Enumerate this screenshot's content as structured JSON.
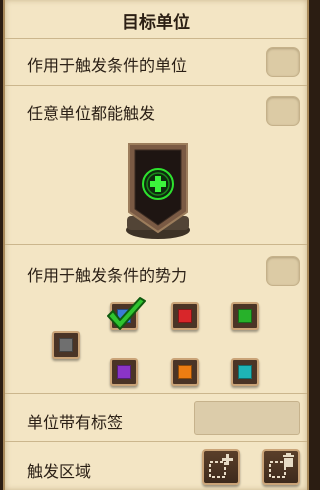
{
  "panel": {
    "title": "目标单位"
  },
  "options": {
    "trigger_unit_label": "作用于触发条件的单位",
    "any_unit_label": "任意单位都能触发",
    "trigger_force_label": "作用于触发条件的势力",
    "unit_tag_label": "单位带有标签",
    "trigger_area_label": "触发区域"
  },
  "unit_tag": {
    "value": ""
  },
  "team_colors": [
    {
      "name": "gray",
      "color": "#6f6f6f"
    },
    {
      "name": "blue",
      "color": "#3b7bd6"
    },
    {
      "name": "red",
      "color": "#d8262a"
    },
    {
      "name": "green",
      "color": "#27b12a"
    },
    {
      "name": "purple",
      "color": "#8a34c7"
    },
    {
      "name": "orange",
      "color": "#ee7d12"
    },
    {
      "name": "teal",
      "color": "#1eb4b6"
    }
  ],
  "selected_team": "blue",
  "icons": {
    "add_unit": "plus-icon",
    "add_area": "add-area-icon",
    "delete_area": "delete-area-icon"
  }
}
